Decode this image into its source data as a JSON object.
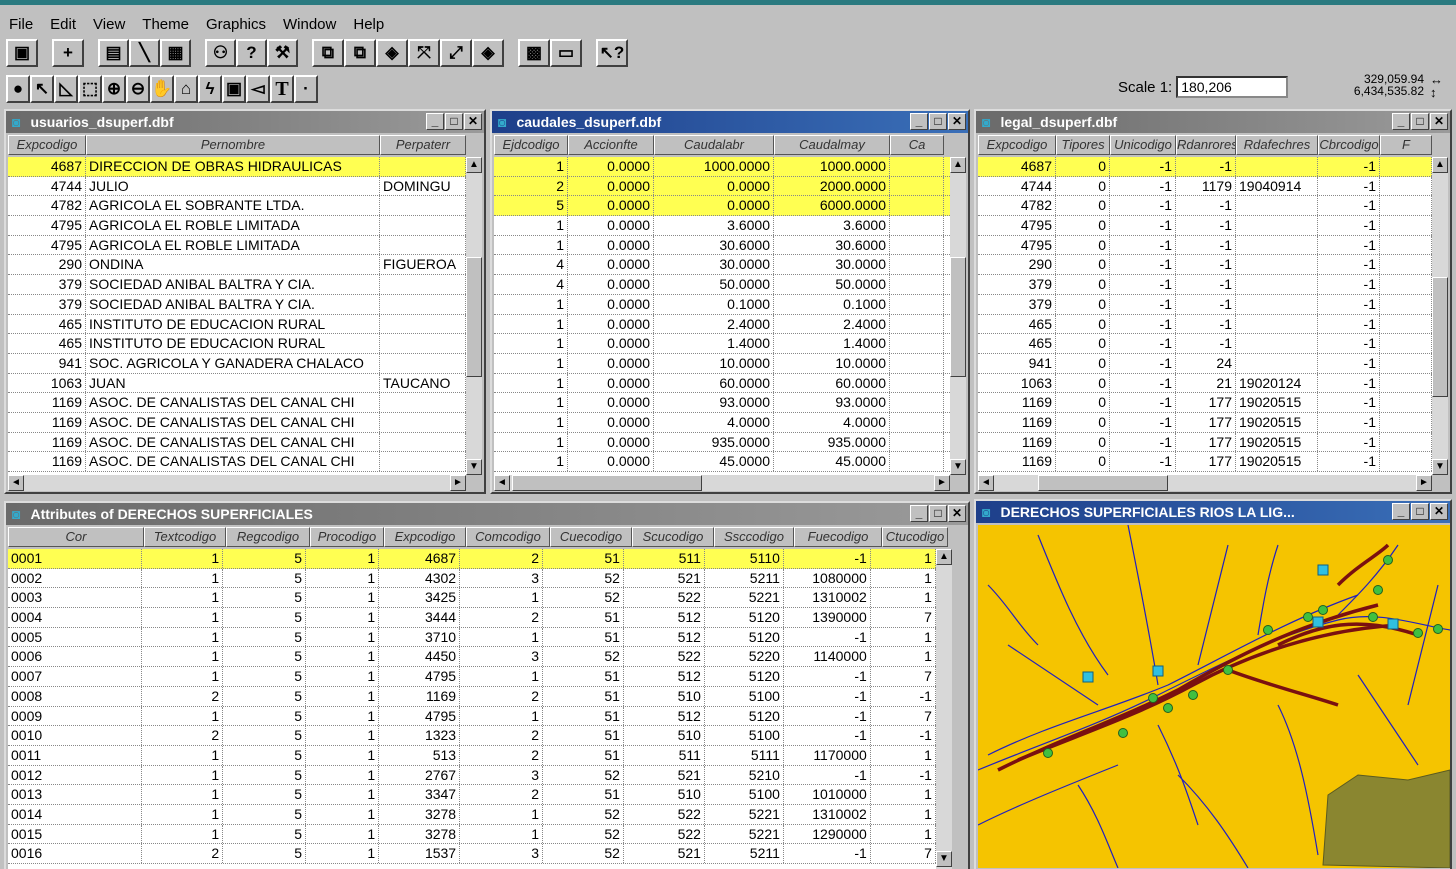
{
  "menu": [
    "File",
    "Edit",
    "View",
    "Theme",
    "Graphics",
    "Window",
    "Help"
  ],
  "toolbar1_icons": [
    "save-icon",
    "add-theme-icon",
    "table-icon",
    "chart-icon",
    "layout-icon",
    "find-icon",
    "query-icon",
    "hotlink-icon",
    "open-table-icon",
    "edit-table-icon",
    "select-all-icon",
    "zoom-selected-icon",
    "zoom-extent-icon",
    "back-icon",
    "properties-icon",
    "view-icon",
    "help-icon"
  ],
  "toolbar2_icons": [
    "identify-icon",
    "pointer-icon",
    "vertex-icon",
    "select-feature-icon",
    "zoom-in-icon",
    "zoom-out-icon",
    "pan-icon",
    "measure-icon",
    "hotlink-tool-icon",
    "label-icon",
    "callout-icon",
    "text-icon",
    "draw-point-icon"
  ],
  "toolbar2_text_glyph": "T",
  "scale": {
    "label": "Scale 1:",
    "value": "180,206"
  },
  "coords": {
    "x": "329,059.94",
    "y": "6,434,535.82"
  },
  "windows": {
    "usuarios": {
      "title": "usuarios_dsuperf.dbf",
      "headers": [
        "Expcodigo",
        "Pernombre",
        "Perpaterr"
      ],
      "rows": [
        [
          "4687",
          "DIRECCION DE OBRAS HIDRAULICAS",
          ""
        ],
        [
          "4744",
          "JULIO",
          "DOMINGU"
        ],
        [
          "4782",
          "AGRICOLA EL SOBRANTE LTDA.",
          ""
        ],
        [
          "4795",
          "AGRICOLA EL ROBLE LIMITADA",
          ""
        ],
        [
          "4795",
          "AGRICOLA EL ROBLE LIMITADA",
          ""
        ],
        [
          "290",
          "ONDINA",
          "FIGUEROA"
        ],
        [
          "379",
          "SOCIEDAD ANIBAL BALTRA Y CIA.",
          ""
        ],
        [
          "379",
          "SOCIEDAD ANIBAL BALTRA Y CIA.",
          ""
        ],
        [
          "465",
          "INSTITUTO DE EDUCACION RURAL",
          ""
        ],
        [
          "465",
          "INSTITUTO DE EDUCACION RURAL",
          ""
        ],
        [
          "941",
          "SOC. AGRICOLA Y GANADERA CHALACO",
          ""
        ],
        [
          "1063",
          "JUAN",
          "TAUCANO"
        ],
        [
          "1169",
          "ASOC. DE CANALISTAS DEL CANAL CHI",
          ""
        ],
        [
          "1169",
          "ASOC. DE CANALISTAS DEL CANAL CHI",
          ""
        ],
        [
          "1169",
          "ASOC. DE CANALISTAS DEL CANAL CHI",
          ""
        ],
        [
          "1169",
          "ASOC. DE CANALISTAS DEL CANAL CHI",
          ""
        ]
      ]
    },
    "caudales": {
      "title": "caudales_dsuperf.dbf",
      "headers": [
        "Ejdcodigo",
        "Accionfte",
        "Caudalabr",
        "Caudalmay",
        "Ca"
      ],
      "rows": [
        [
          "1",
          "0.0000",
          "1000.0000",
          "1000.0000",
          ""
        ],
        [
          "2",
          "0.0000",
          "0.0000",
          "2000.0000",
          ""
        ],
        [
          "5",
          "0.0000",
          "0.0000",
          "6000.0000",
          ""
        ],
        [
          "1",
          "0.0000",
          "3.6000",
          "3.6000",
          ""
        ],
        [
          "1",
          "0.0000",
          "30.6000",
          "30.6000",
          ""
        ],
        [
          "4",
          "0.0000",
          "30.0000",
          "30.0000",
          ""
        ],
        [
          "4",
          "0.0000",
          "50.0000",
          "50.0000",
          ""
        ],
        [
          "1",
          "0.0000",
          "0.1000",
          "0.1000",
          ""
        ],
        [
          "1",
          "0.0000",
          "2.4000",
          "2.4000",
          ""
        ],
        [
          "1",
          "0.0000",
          "1.4000",
          "1.4000",
          ""
        ],
        [
          "1",
          "0.0000",
          "10.0000",
          "10.0000",
          ""
        ],
        [
          "1",
          "0.0000",
          "60.0000",
          "60.0000",
          ""
        ],
        [
          "1",
          "0.0000",
          "93.0000",
          "93.0000",
          ""
        ],
        [
          "1",
          "0.0000",
          "4.0000",
          "4.0000",
          ""
        ],
        [
          "1",
          "0.0000",
          "935.0000",
          "935.0000",
          ""
        ],
        [
          "1",
          "0.0000",
          "45.0000",
          "45.0000",
          ""
        ]
      ]
    },
    "legal": {
      "title": "legal_dsuperf.dbf",
      "headers": [
        "Expcodigo",
        "Tipores",
        "Unicodigo",
        "Rdanrores",
        "Rdafechres",
        "Cbrcodigo",
        "F"
      ],
      "rows": [
        [
          "4687",
          "0",
          "-1",
          "-1",
          "",
          "-1",
          ""
        ],
        [
          "4744",
          "0",
          "-1",
          "1179",
          "19040914",
          "-1",
          ""
        ],
        [
          "4782",
          "0",
          "-1",
          "-1",
          "",
          "-1",
          ""
        ],
        [
          "4795",
          "0",
          "-1",
          "-1",
          "",
          "-1",
          ""
        ],
        [
          "4795",
          "0",
          "-1",
          "-1",
          "",
          "-1",
          ""
        ],
        [
          "290",
          "0",
          "-1",
          "-1",
          "",
          "-1",
          ""
        ],
        [
          "379",
          "0",
          "-1",
          "-1",
          "",
          "-1",
          ""
        ],
        [
          "379",
          "0",
          "-1",
          "-1",
          "",
          "-1",
          ""
        ],
        [
          "465",
          "0",
          "-1",
          "-1",
          "",
          "-1",
          ""
        ],
        [
          "465",
          "0",
          "-1",
          "-1",
          "",
          "-1",
          ""
        ],
        [
          "941",
          "0",
          "-1",
          "24",
          "",
          "-1",
          ""
        ],
        [
          "1063",
          "0",
          "-1",
          "21",
          "19020124",
          "-1",
          ""
        ],
        [
          "1169",
          "0",
          "-1",
          "177",
          "19020515",
          "-1",
          ""
        ],
        [
          "1169",
          "0",
          "-1",
          "177",
          "19020515",
          "-1",
          ""
        ],
        [
          "1169",
          "0",
          "-1",
          "177",
          "19020515",
          "-1",
          ""
        ],
        [
          "1169",
          "0",
          "-1",
          "177",
          "19020515",
          "-1",
          ""
        ]
      ]
    },
    "attributes": {
      "title": "Attributes of DERECHOS SUPERFICIALES",
      "headers": [
        "Cor",
        "Textcodigo",
        "Regcodigo",
        "Procodigo",
        "Expcodigo",
        "Comcodigo",
        "Cuecodigo",
        "Scucodigo",
        "Ssccodigo",
        "Fuecodigo",
        "Ctucodigo"
      ],
      "rows": [
        [
          "0001",
          "1",
          "5",
          "1",
          "4687",
          "2",
          "51",
          "511",
          "5110",
          "-1",
          "1"
        ],
        [
          "0002",
          "1",
          "5",
          "1",
          "4302",
          "3",
          "52",
          "521",
          "5211",
          "1080000",
          "1"
        ],
        [
          "0003",
          "1",
          "5",
          "1",
          "3425",
          "1",
          "52",
          "522",
          "5221",
          "1310002",
          "1"
        ],
        [
          "0004",
          "1",
          "5",
          "1",
          "3444",
          "2",
          "51",
          "512",
          "5120",
          "1390000",
          "7"
        ],
        [
          "0005",
          "1",
          "5",
          "1",
          "3710",
          "1",
          "51",
          "512",
          "5120",
          "-1",
          "1"
        ],
        [
          "0006",
          "1",
          "5",
          "1",
          "4450",
          "3",
          "52",
          "522",
          "5220",
          "1140000",
          "1"
        ],
        [
          "0007",
          "1",
          "5",
          "1",
          "4795",
          "1",
          "51",
          "512",
          "5120",
          "-1",
          "7"
        ],
        [
          "0008",
          "2",
          "5",
          "1",
          "1169",
          "2",
          "51",
          "510",
          "5100",
          "-1",
          "-1"
        ],
        [
          "0009",
          "1",
          "5",
          "1",
          "4795",
          "1",
          "51",
          "512",
          "5120",
          "-1",
          "7"
        ],
        [
          "0010",
          "2",
          "5",
          "1",
          "1323",
          "2",
          "51",
          "510",
          "5100",
          "-1",
          "-1"
        ],
        [
          "0011",
          "1",
          "5",
          "1",
          "513",
          "2",
          "51",
          "511",
          "5111",
          "1170000",
          "1"
        ],
        [
          "0012",
          "1",
          "5",
          "1",
          "2767",
          "3",
          "52",
          "521",
          "5210",
          "-1",
          "-1"
        ],
        [
          "0013",
          "1",
          "5",
          "1",
          "3347",
          "2",
          "51",
          "510",
          "5100",
          "1010000",
          "1"
        ],
        [
          "0014",
          "1",
          "5",
          "1",
          "3278",
          "1",
          "52",
          "522",
          "5221",
          "1310002",
          "1"
        ],
        [
          "0015",
          "1",
          "5",
          "1",
          "3278",
          "1",
          "52",
          "522",
          "5221",
          "1290000",
          "1"
        ],
        [
          "0016",
          "2",
          "5",
          "1",
          "1537",
          "3",
          "52",
          "521",
          "5211",
          "-1",
          "7"
        ]
      ]
    },
    "map": {
      "title": "DERECHOS SUPERFICIALES RIOS LA LIG..."
    }
  },
  "colors": {
    "selected_row": "#ffff52",
    "map_bg": "#f5c400",
    "rivers": "#2020c0",
    "canals": "#7a1010",
    "points": "#40c040",
    "stations": "#30c0e0",
    "hills": "#8a8630"
  }
}
